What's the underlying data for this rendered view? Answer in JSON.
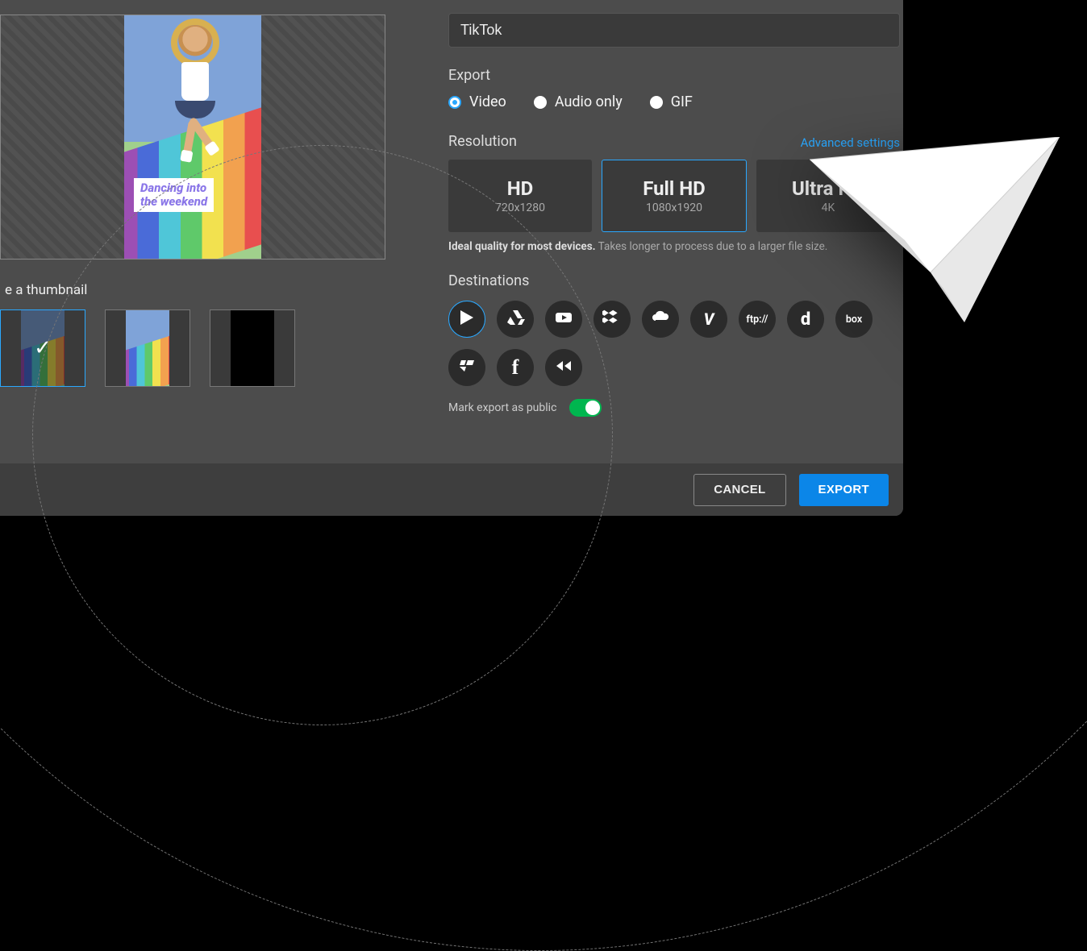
{
  "name_field": {
    "value": "TikTok"
  },
  "export": {
    "label": "Export",
    "options": [
      "Video",
      "Audio only",
      "GIF"
    ],
    "selected": "Video"
  },
  "resolution": {
    "label": "Resolution",
    "advanced_link": "Advanced settings",
    "options": [
      {
        "title": "HD",
        "sub": "720x1280"
      },
      {
        "title": "Full HD",
        "sub": "1080x1920"
      },
      {
        "title": "Ultra HD",
        "sub": "4K"
      }
    ],
    "selected": "Full HD",
    "note_bold": "Ideal quality for most devices.",
    "note_rest": " Takes longer to process due to a larger file size."
  },
  "preview": {
    "caption_line1": "Dancing into",
    "caption_line2": "the weekend"
  },
  "thumbnails": {
    "label": "e a thumbnail",
    "selected_index": 0,
    "items": [
      {
        "kind": "caption"
      },
      {
        "kind": "plain"
      },
      {
        "kind": "black"
      }
    ]
  },
  "destinations": {
    "label": "Destinations",
    "items": [
      {
        "name": "wevideo",
        "label": "▶",
        "selected": true
      },
      {
        "name": "google-drive",
        "label": "drive-icon"
      },
      {
        "name": "youtube",
        "label": "youtube-icon"
      },
      {
        "name": "dropbox",
        "label": "dropbox-icon"
      },
      {
        "name": "onedrive",
        "label": "onedrive-icon"
      },
      {
        "name": "vimeo",
        "label": "V"
      },
      {
        "name": "ftp",
        "label": "ftp://"
      },
      {
        "name": "dailymotion",
        "label": "d"
      },
      {
        "name": "box",
        "label": "box"
      },
      {
        "name": "brightcove",
        "label": "brightcove-icon"
      },
      {
        "name": "facebook",
        "label": "f"
      },
      {
        "name": "rewind",
        "label": "rewind-icon"
      }
    ]
  },
  "public": {
    "label": "Mark export as public",
    "value": true
  },
  "footer": {
    "cancel": "CANCEL",
    "export": "EXPORT"
  }
}
